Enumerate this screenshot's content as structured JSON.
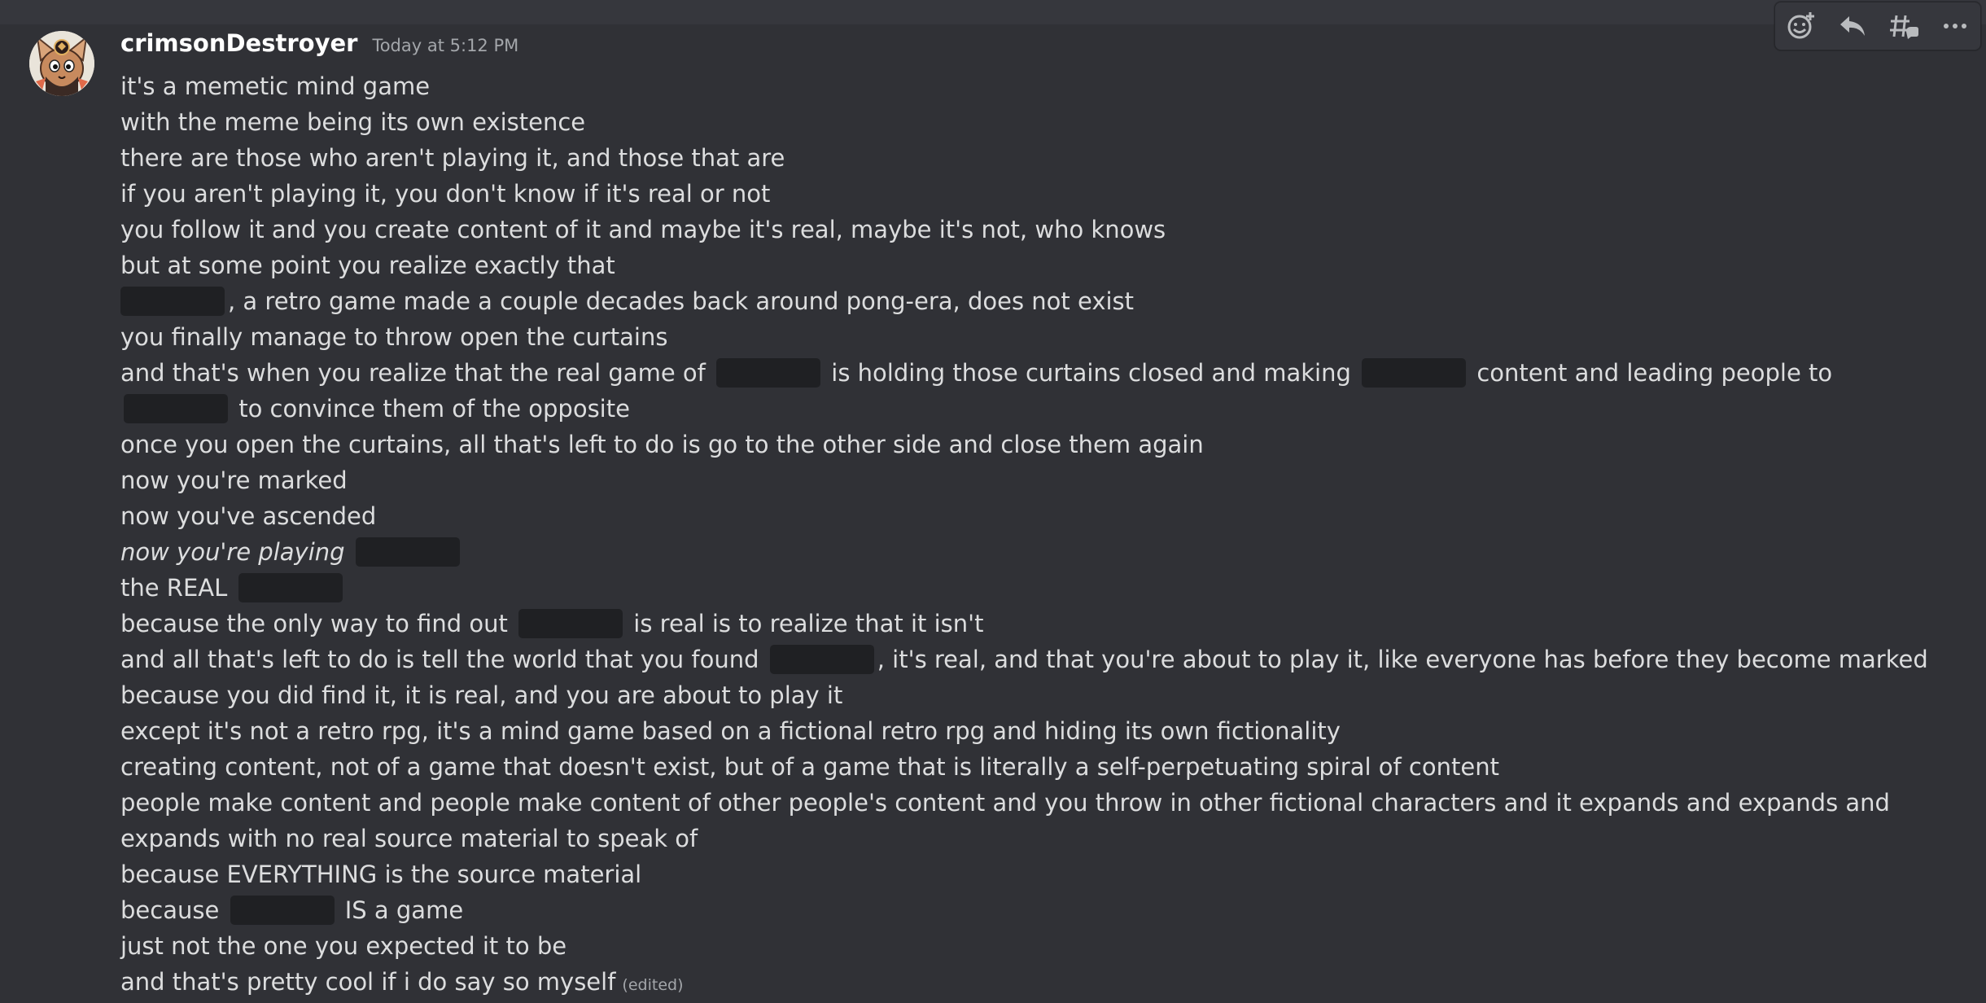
{
  "message": {
    "username": "crimsonDestroyer",
    "timestamp": "Today at 5:12 PM",
    "edited_label": "(edited)",
    "lines": {
      "l1": "it's a memetic mind game",
      "l2": "with the meme being its own existence",
      "l3": "there are those who aren't playing it, and those that are",
      "l4": "if you aren't playing it, you don't know if it's real or not",
      "l5": "you follow it and you create content of it and maybe it's real, maybe it's not, who knows",
      "l6": "but at some point you realize exactly that",
      "l7_after": ", a retro game made a couple decades back around pong-era, does not exist",
      "l8": "you finally manage to throw open the curtains",
      "l9_a": "and that's when you realize that the real game of",
      "l9_b": "is holding those curtains closed and making",
      "l9_c": "content and leading people to",
      "l9_d": "to convince them of the opposite",
      "l10": "once you open the curtains, all that's left to do is go to the other side and close them again",
      "l11": "now you're marked",
      "l12": "now you've ascended",
      "l13": "now you're playing",
      "l14": "the REAL",
      "l15_a": "because the only way to find out",
      "l15_b": "is real is to realize that it isn't",
      "l16_a": "and all that's left to do is tell the world that you found",
      "l16_b": ", it's real, and that you're about to play it, like everyone has before they become marked",
      "l17": "because you did find it, it is real, and you are about to play it",
      "l18": "except it's not a retro rpg, it's a mind game based on a fictional retro rpg and hiding its own fictionality",
      "l19": "creating content, not of a game that doesn't exist, but of a game that is literally a self-perpetuating spiral of content",
      "l20": "people make content and people make content of other people's content and you throw in other fictional characters and it expands and expands and expands with no real source material to speak of",
      "l21": "because EVERYTHING is the source material",
      "l22_a": "because",
      "l22_b": "IS a game",
      "l23": "just not the one you expected it to be",
      "l24": "and that's pretty cool if i do say so myself"
    }
  },
  "toolbar": {
    "icons": [
      "add-reaction-icon",
      "reply-icon",
      "create-thread-icon",
      "more-icon"
    ]
  },
  "colors": {
    "background": "#303136",
    "text": "#dcddde",
    "username": "#ffffff",
    "muted": "#a3a6aa",
    "spoiler": "#1f2023"
  }
}
